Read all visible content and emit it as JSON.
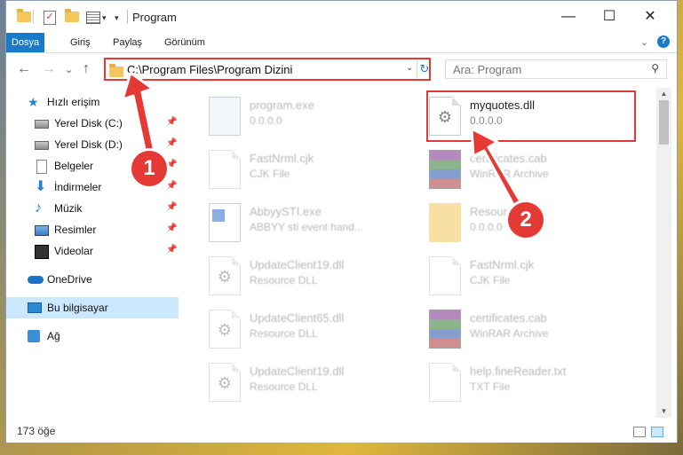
{
  "window": {
    "title": "Program",
    "minimize_glyph": "—",
    "maximize_glyph": "☐",
    "close_glyph": "✕"
  },
  "ribbon": {
    "tabs": [
      {
        "label": "Dosya"
      },
      {
        "label": "Giriş"
      },
      {
        "label": "Paylaş"
      },
      {
        "label": "Görünüm"
      }
    ],
    "help_glyph": "?"
  },
  "navbar": {
    "back_glyph": "←",
    "forward_glyph": "→",
    "recent_glyph": "⌄",
    "up_glyph": "↑",
    "address": "C:\\Program Files\\Program Dizini",
    "search_placeholder": "Ara: Program"
  },
  "navpane": {
    "items": [
      {
        "label": "Hızlı erişim",
        "icon": "star-icon"
      },
      {
        "label": "Yerel Disk (C:)",
        "icon": "drive-icon"
      },
      {
        "label": "Yerel Disk (D:)",
        "icon": "drive-icon"
      },
      {
        "label": "Belgeler",
        "icon": "documents-icon"
      },
      {
        "label": "İndirmeler",
        "icon": "download-icon"
      },
      {
        "label": "Müzik",
        "icon": "music-icon"
      },
      {
        "label": "Resimler",
        "icon": "pictures-icon"
      },
      {
        "label": "Videolar",
        "icon": "videos-icon"
      },
      {
        "label": "OneDrive",
        "icon": "cloud-icon"
      },
      {
        "label": "Bu bilgisayar",
        "icon": "computer-icon"
      },
      {
        "label": "Ağ",
        "icon": "network-icon"
      }
    ]
  },
  "files": [
    {
      "name": "program.exe",
      "sub": "0.0.0.0",
      "icon": "exe-icon",
      "highlighted": false
    },
    {
      "name": "myquotes.dll",
      "sub": "0.0.0.0",
      "icon": "dll-icon",
      "highlighted": true
    },
    {
      "name": "FastNrml.cjk",
      "sub": "CJK File",
      "icon": "file-icon",
      "highlighted": false
    },
    {
      "name": "certificates.cab",
      "sub": "WinRAR Archive",
      "icon": "archive-icon",
      "highlighted": false
    },
    {
      "name": "AbbyySTI.exe",
      "sub": "ABBYY sti event hand...",
      "icon": "app-icon",
      "highlighted": false
    },
    {
      "name": "Resources",
      "sub": "0.0.0.0",
      "icon": "folder-icon",
      "highlighted": false
    },
    {
      "name": "UpdateClient19.dll",
      "sub": "Resource DLL",
      "icon": "dll-icon",
      "highlighted": false
    },
    {
      "name": "FastNrml.cjk",
      "sub": "CJK File",
      "icon": "file-icon",
      "highlighted": false
    },
    {
      "name": "UpdateClient65.dll",
      "sub": "Resource DLL",
      "icon": "dll-icon",
      "highlighted": false
    },
    {
      "name": "certificates.cab",
      "sub": "WinRAR Archive",
      "icon": "archive-icon",
      "highlighted": false
    },
    {
      "name": "UpdateClient19.dll",
      "sub": "Resource DLL",
      "icon": "dll-icon",
      "highlighted": false
    },
    {
      "name": "help.fineReader.txt",
      "sub": "TXT File",
      "icon": "file-icon",
      "highlighted": false
    }
  ],
  "status": {
    "item_count": "173 öğe"
  },
  "annotations": {
    "callout_1": "1",
    "callout_2": "2",
    "accent_color": "#e53935"
  }
}
